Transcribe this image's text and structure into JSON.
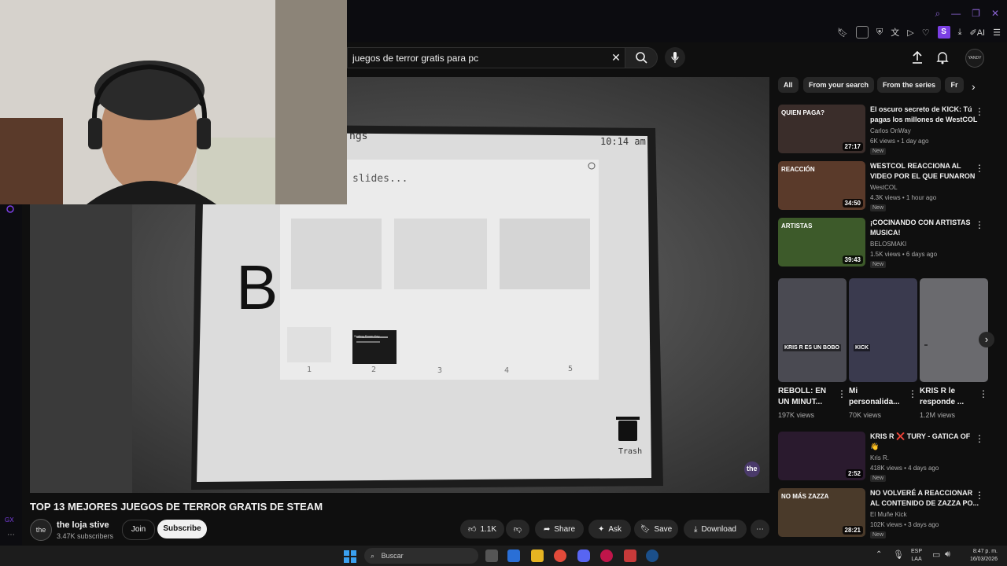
{
  "browser": {
    "toolbar_ai_label": "AI",
    "profile_letter": "S"
  },
  "header": {
    "search": {
      "value": "juegos de terror gratis para pc"
    },
    "avatar_text": "YANDY"
  },
  "player": {
    "screen_header": "ngs",
    "screen_time": "10:14 am",
    "screen_dialog_text": "slides...",
    "screen_letter": "B",
    "screen_slide_numbers": [
      "1",
      "2",
      "3",
      "4",
      "5"
    ],
    "screen_slide2_label": "Sorting Room Key",
    "screen_trash_label": "Trash",
    "watermark": "the"
  },
  "video": {
    "title": "TOP 13 MEJORES JUEGOS DE TERROR GRATIS DE STEAM",
    "channel_name": "the loja stive",
    "channel_avatar": "the",
    "subscribers": "3.47K subscribers",
    "join_label": "Join",
    "subscribe_label": "Subscribe",
    "like_count": "1.1K",
    "share_label": "Share",
    "ask_label": "Ask",
    "save_label": "Save",
    "download_label": "Download"
  },
  "chips": [
    "All",
    "From your search",
    "From the series",
    "Fr"
  ],
  "recommendations": [
    {
      "title": "El oscuro secreto de KICK: Tú pagas los millones de WestCOL",
      "channel": "Carlos OnWay",
      "meta": "6K views • 1 day ago",
      "badge": "New",
      "duration": "27:17",
      "thumb_text": "QUIEN PAGA?",
      "color": "#3a2d2a"
    },
    {
      "title": "WESTCOL REACCIONA AL VIDEO POR EL QUE FUNARON ...",
      "channel": "WestCOL",
      "meta": "4.3K views • 1 hour ago",
      "badge": "New",
      "duration": "34:50",
      "thumb_text": "REACCIÓN",
      "color": "#5a3a2a"
    },
    {
      "title": "¡COCINANDO CON ARTISTAS MUSICA!",
      "channel": "BELOSMAKI",
      "meta": "1.5K views • 6 days ago",
      "badge": "New",
      "duration": "39:43",
      "thumb_text": "ARTISTAS",
      "color": "#3d5a2a"
    }
  ],
  "shorts": [
    {
      "title": "REBOLL: EN UN MINUT...",
      "views": "197K views",
      "thumb_text": "KRIS R ES UN BOBO",
      "color": "#4a4a52"
    },
    {
      "title": "Mi personalida...",
      "views": "70K views",
      "thumb_text": "KICK",
      "color": "#3a3a4e"
    },
    {
      "title": "KRIS R le responde ...",
      "views": "1.2M views",
      "thumb_text": "",
      "color": "#6a6a6e"
    }
  ],
  "recommendations2": [
    {
      "title": "KRIS R ❌ TURY - GATICA OF 👋",
      "channel": "Kris R.",
      "meta": "418K views • 4 days ago",
      "badge": "New",
      "duration": "2:52",
      "thumb_text": "",
      "color": "#2a1a2e"
    },
    {
      "title": "NO VOLVERÉ A REACCIONAR AL CONTENIDO DE ZAZZA PO...",
      "channel": "El Muñe Kick",
      "meta": "102K views • 3 days ago",
      "badge": "New",
      "duration": "28:21",
      "thumb_text": "NO MÁS ZAZZA",
      "color": "#4a3a2a"
    }
  ],
  "taskbar": {
    "search_placeholder": "Buscar",
    "lang": "ESP",
    "lang_sub": "LAA",
    "time": "8:47 p. m.",
    "date": "16/03/2026"
  }
}
